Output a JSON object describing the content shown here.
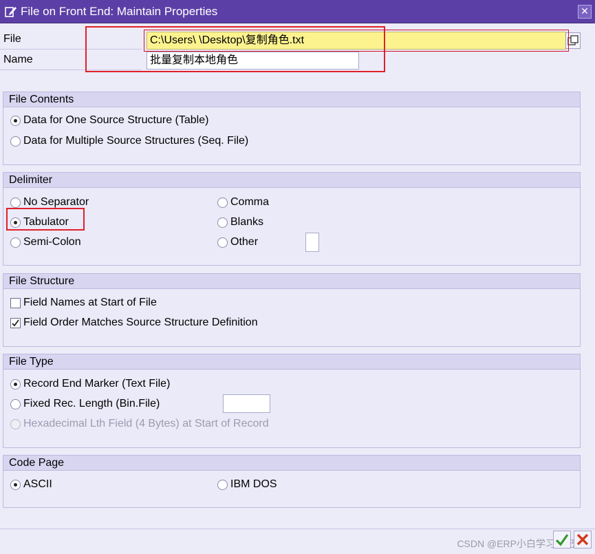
{
  "window": {
    "title": "File on Front End: Maintain Properties"
  },
  "header": {
    "file_label": "File",
    "file_value": "C:\\Users\\        \\Desktop\\复制角色.txt",
    "name_label": "Name",
    "name_value": "批量复制本地角色"
  },
  "file_contents": {
    "title": "File Contents",
    "options": [
      {
        "label": "Data for One Source Structure (Table)",
        "selected": true
      },
      {
        "label": "Data for Multiple Source Structures (Seq. File)",
        "selected": false
      }
    ]
  },
  "delimiter": {
    "title": "Delimiter",
    "options": [
      {
        "label": "No Separator",
        "selected": false
      },
      {
        "label": "Tabulator",
        "selected": true
      },
      {
        "label": "Semi-Colon",
        "selected": false
      },
      {
        "label": "Comma",
        "selected": false
      },
      {
        "label": "Blanks",
        "selected": false
      },
      {
        "label": "Other",
        "selected": false
      }
    ],
    "other_value": ""
  },
  "file_structure": {
    "title": "File Structure",
    "options": [
      {
        "label": "Field Names at Start of File",
        "checked": false
      },
      {
        "label": "Field Order Matches Source Structure Definition",
        "checked": true
      }
    ]
  },
  "file_type": {
    "title": "File Type",
    "options": [
      {
        "label": "Record End Marker (Text File)",
        "selected": true,
        "enabled": true
      },
      {
        "label": "Fixed Rec. Length (Bin.File)",
        "selected": false,
        "enabled": true
      },
      {
        "label": "Hexadecimal Lth Field (4 Bytes) at Start of Record",
        "selected": false,
        "enabled": false
      }
    ],
    "fixed_length_value": ""
  },
  "code_page": {
    "title": "Code Page",
    "options": [
      {
        "label": "ASCII",
        "selected": true
      },
      {
        "label": "IBM DOS",
        "selected": false
      }
    ]
  },
  "footer": {
    "watermark": "CSDN @ERP小白学习笔记"
  },
  "colors": {
    "titlebar": "#5c3fa6",
    "background": "#ecebf8",
    "group_header": "#d8d5f1",
    "required_field": "#fcf38f",
    "highlight_box": "#e0202a"
  }
}
